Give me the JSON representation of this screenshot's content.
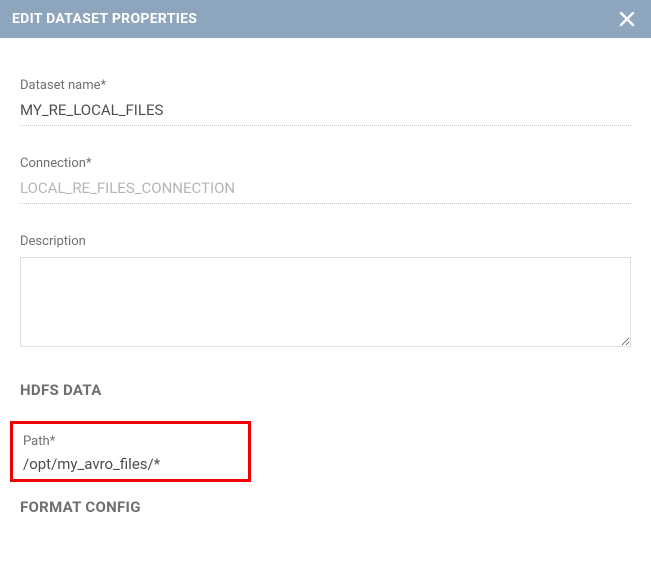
{
  "header": {
    "title": "EDIT DATASET PROPERTIES"
  },
  "fields": {
    "datasetName": {
      "label": "Dataset name*",
      "value": "MY_RE_LOCAL_FILES"
    },
    "connection": {
      "label": "Connection*",
      "value": "LOCAL_RE_FILES_CONNECTION"
    },
    "description": {
      "label": "Description",
      "value": ""
    },
    "path": {
      "label": "Path*",
      "value": "/opt/my_avro_files/*"
    }
  },
  "sections": {
    "hdfs": "HDFS DATA",
    "format": "FORMAT CONFIG"
  }
}
